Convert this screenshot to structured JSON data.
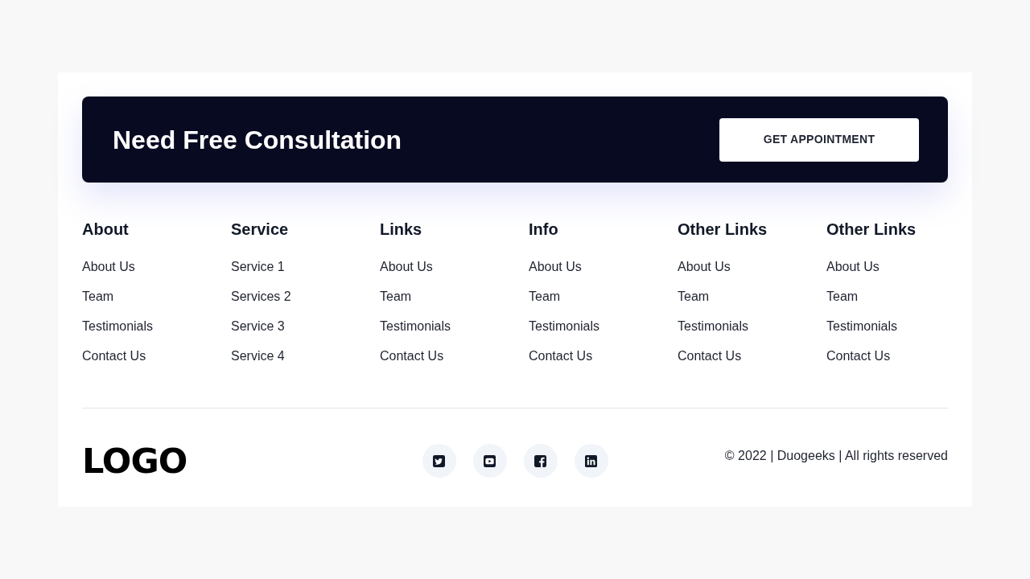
{
  "cta": {
    "title": "Need Free Consultation",
    "button": "GET APPOINTMENT"
  },
  "columns": [
    {
      "heading": "About",
      "links": [
        "About Us",
        "Team",
        "Testimonials",
        "Contact Us"
      ]
    },
    {
      "heading": "Service",
      "links": [
        "Service 1",
        "Services 2",
        "Service 3",
        "Service 4"
      ]
    },
    {
      "heading": "Links",
      "links": [
        "About Us",
        "Team",
        "Testimonials",
        "Contact Us"
      ]
    },
    {
      "heading": "Info",
      "links": [
        "About Us",
        "Team",
        "Testimonials",
        "Contact Us"
      ]
    },
    {
      "heading": "Other Links",
      "links": [
        "About Us",
        "Team",
        "Testimonials",
        "Contact Us"
      ]
    },
    {
      "heading": "Other Links",
      "links": [
        "About Us",
        "Team",
        "Testimonials",
        "Contact Us"
      ]
    }
  ],
  "logo": "LOGO",
  "copyright": "© 2022 | Duogeeks | All rights reserved"
}
